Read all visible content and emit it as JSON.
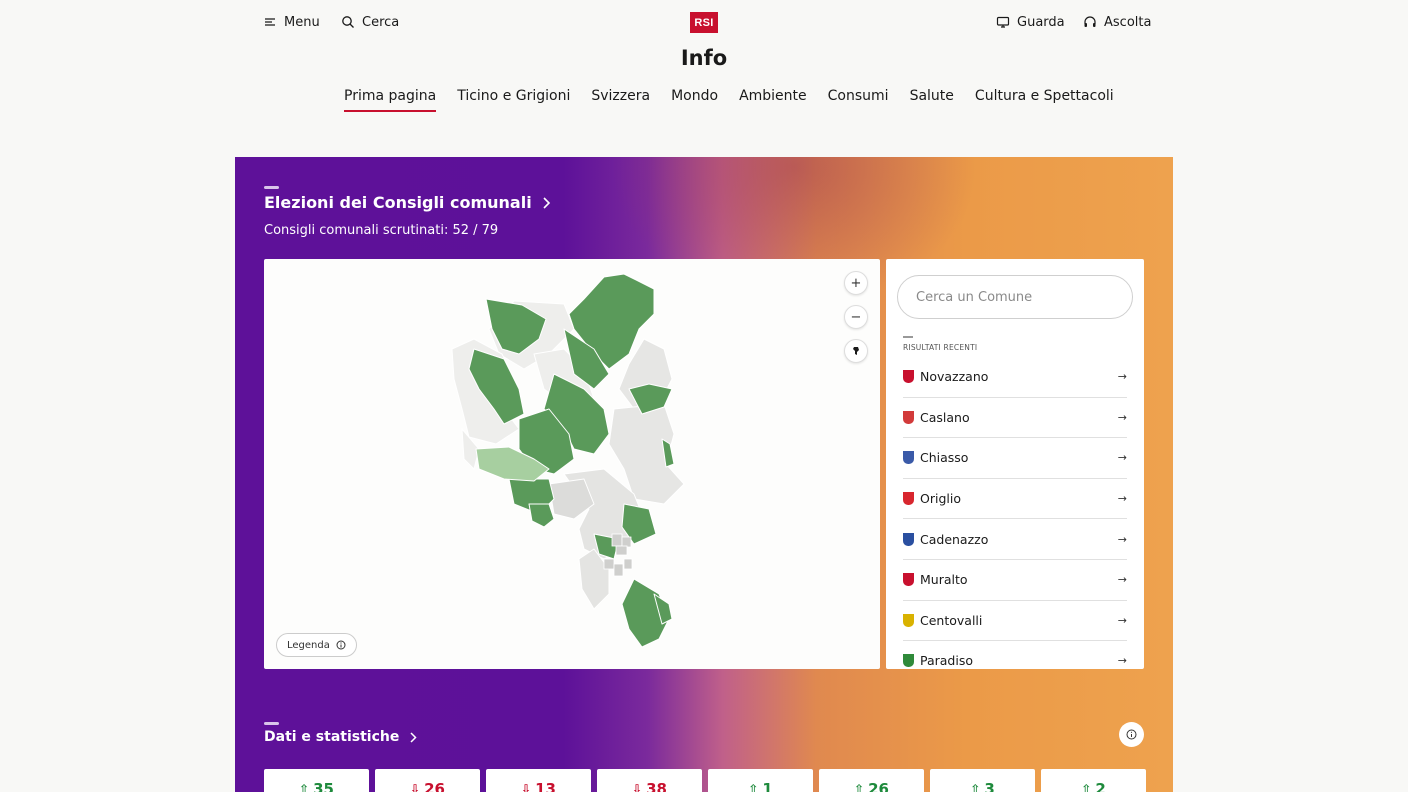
{
  "header": {
    "menu_label": "Menu",
    "search_label": "Cerca",
    "logo_text": "RSI",
    "watch_label": "Guarda",
    "listen_label": "Ascolta"
  },
  "section_title": "Info",
  "nav": {
    "items": [
      {
        "label": "Prima pagina",
        "active": true
      },
      {
        "label": "Ticino e Grigioni"
      },
      {
        "label": "Svizzera"
      },
      {
        "label": "Mondo"
      },
      {
        "label": "Ambiente"
      },
      {
        "label": "Consumi"
      },
      {
        "label": "Salute"
      },
      {
        "label": "Cultura e Spettacoli"
      }
    ]
  },
  "hero": {
    "title": "Elezioni dei Consigli comunali",
    "subtitle": "Consigli comunali scrutinati: 52 / 79"
  },
  "map": {
    "zoom_in": "+",
    "zoom_out": "−",
    "legend_label": "Legenda",
    "colors": {
      "counted": "#5a9a5a",
      "partial": "#a7cfa0",
      "pending": "#e4e4e4"
    }
  },
  "search": {
    "placeholder": "Cerca un Comune",
    "recent_label": "RISULTATI RECENTI",
    "results": [
      {
        "name": "Novazzano",
        "crest": "#c8102e"
      },
      {
        "name": "Caslano",
        "crest": "#d23a3a"
      },
      {
        "name": "Chiasso",
        "crest": "#3a5aa8"
      },
      {
        "name": "Origlio",
        "crest": "#d8262e"
      },
      {
        "name": "Cadenazzo",
        "crest": "#2a4fa0"
      },
      {
        "name": "Muralto",
        "crest": "#c8102e"
      },
      {
        "name": "Centovalli",
        "crest": "#d9b200"
      },
      {
        "name": "Paradiso",
        "crest": "#2f8a3a"
      }
    ]
  },
  "stats": {
    "title": "Dati e statistiche",
    "cards": [
      {
        "value": "35",
        "dir": "up"
      },
      {
        "value": "26",
        "dir": "down"
      },
      {
        "value": "13",
        "dir": "down"
      },
      {
        "value": "38",
        "dir": "down"
      },
      {
        "value": "1",
        "dir": "up"
      },
      {
        "value": "26",
        "dir": "up"
      },
      {
        "value": "3",
        "dir": "up"
      },
      {
        "value": "2",
        "dir": "up"
      }
    ]
  }
}
